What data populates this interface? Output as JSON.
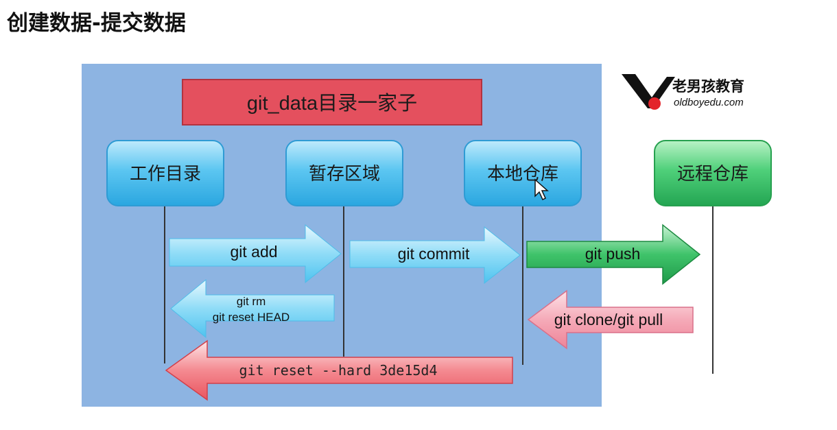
{
  "title": "创建数据-提交数据",
  "banner": "git_data目录一家子",
  "logo": {
    "name_cn": "老男孩教育",
    "site": "oldboyedu.com"
  },
  "nodes": {
    "workdir": "工作目录",
    "staging": "暂存区域",
    "local_repo": "本地仓库",
    "remote_repo": "远程仓库"
  },
  "arrows": {
    "add": "git  add",
    "commit": "git  commit",
    "push": "git  push",
    "rm_line1": "git  rm",
    "rm_line2": "git reset HEAD",
    "clone_pull": "git  clone/git  pull",
    "reset_hard": "git reset --hard 3de15d4"
  },
  "colors": {
    "panel": "#8db4e2",
    "banner": "#e4505e",
    "node_blue": "#43b6ea",
    "node_green": "#3cc86a",
    "arrow_blue": "#62cdf2",
    "arrow_green": "#2fb45a",
    "arrow_pink": "#f39aab",
    "arrow_red": "#ee5f69"
  }
}
